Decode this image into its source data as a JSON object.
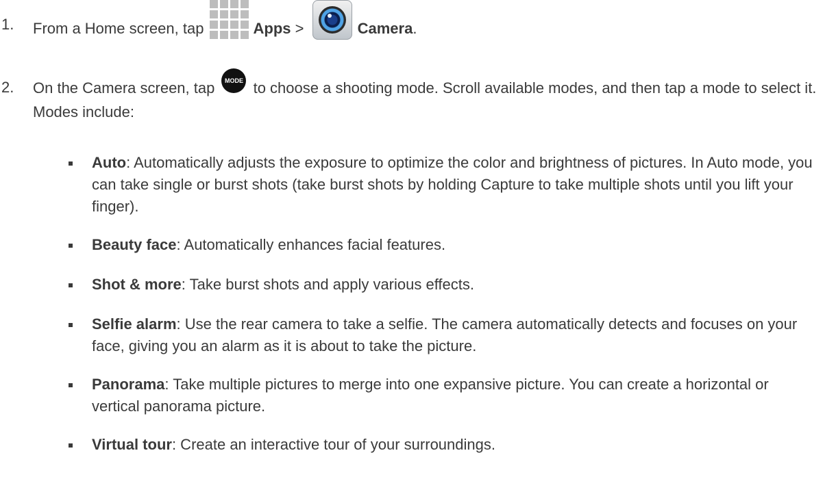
{
  "steps": [
    {
      "number": "1.",
      "text_before": "From a Home screen, tap ",
      "apps_label": "Apps",
      "separator": " > ",
      "camera_label": "Camera",
      "text_after": "."
    },
    {
      "number": "2.",
      "text_before": "On the Camera screen, tap ",
      "mode_icon_text": "MODE",
      "text_after": " to choose a shooting mode. Scroll available modes, and then tap a mode to select it. Modes include:"
    }
  ],
  "modes": [
    {
      "term": "Auto",
      "desc": ": Automatically adjusts the exposure to optimize the color and brightness of pictures. In Auto mode, you can take single or burst shots (take burst shots by holding Capture to take multiple shots until you lift your finger)."
    },
    {
      "term": "Beauty face",
      "desc": ": Automatically enhances facial features."
    },
    {
      "term": "Shot & more",
      "desc": ": Take burst shots and apply various effects."
    },
    {
      "term": "Selfie alarm",
      "desc": ": Use the rear camera to take a selfie. The camera automatically detects and focuses on your face, giving you an alarm as it is about to take the picture."
    },
    {
      "term": "Panorama",
      "desc": ": Take multiple pictures to merge into one expansive picture. You can create a horizontal or vertical panorama picture."
    },
    {
      "term": "Virtual tour",
      "desc": ": Create an interactive tour of your surroundings."
    }
  ],
  "icons": {
    "apps": "apps-grid-icon",
    "camera": "camera-app-icon",
    "mode": "mode-button-icon"
  }
}
